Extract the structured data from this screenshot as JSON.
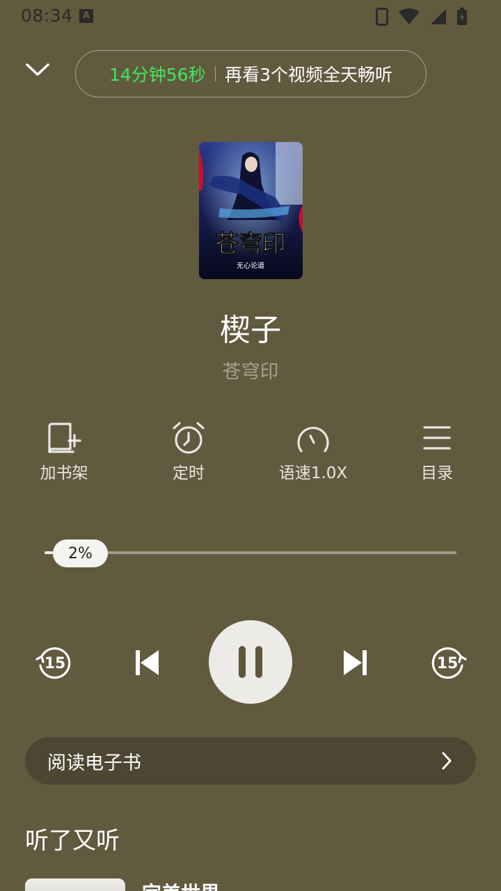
{
  "status_bar": {
    "time": "08:34",
    "notification_badge": "A"
  },
  "header": {
    "collapse_icon": "chevron-down-icon",
    "timer_remaining": "14分钟56秒",
    "timer_promo": "再看3个视频全天畅听"
  },
  "book": {
    "cover_title": "苍穹印",
    "cover_author": "无心论道",
    "chapter_title": "楔子",
    "book_name": "苍穹印"
  },
  "actions": [
    {
      "icon": "bookshelf-add-icon",
      "label": "加书架"
    },
    {
      "icon": "alarm-clock-icon",
      "label": "定时"
    },
    {
      "icon": "speedometer-icon",
      "label": "语速1.0X"
    },
    {
      "icon": "menu-list-icon",
      "label": "目录"
    }
  ],
  "progress": {
    "percent": 2,
    "label": "2%"
  },
  "controls": {
    "rewind_seconds": "15",
    "forward_seconds": "15",
    "state": "playing"
  },
  "read_ebook": {
    "label": "阅读电子书"
  },
  "recommendations": {
    "section_title": "听了又听",
    "items": [
      {
        "title": "完美世界"
      }
    ]
  },
  "colors": {
    "background": "#625a3f",
    "accent_green": "#3ee860",
    "read_bar": "#4c4632"
  }
}
